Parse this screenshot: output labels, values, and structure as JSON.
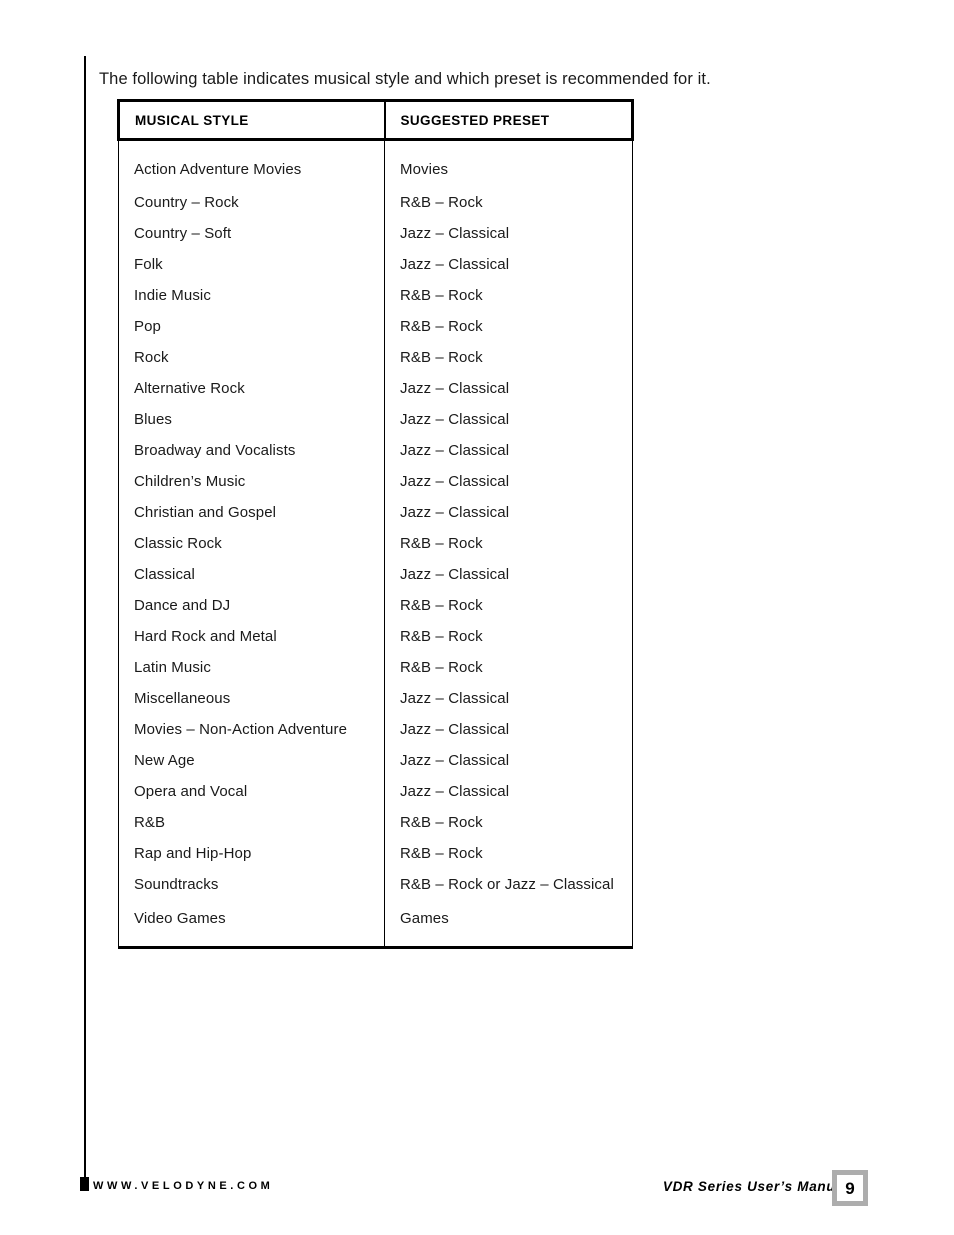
{
  "intro": {
    "text": "The following table indicates musical style and which preset is recommended for it."
  },
  "table": {
    "headers": {
      "style": "MUSICAL STYLE",
      "preset": "SUGGESTED PRESET"
    },
    "rows": [
      {
        "style": "Action Adventure Movies",
        "preset": "Movies"
      },
      {
        "style": "Country – Rock",
        "preset": "R&B – Rock"
      },
      {
        "style": "Country – Soft",
        "preset": "Jazz – Classical"
      },
      {
        "style": "Folk",
        "preset": "Jazz – Classical"
      },
      {
        "style": "Indie Music",
        "preset": "R&B – Rock"
      },
      {
        "style": "Pop",
        "preset": "R&B – Rock"
      },
      {
        "style": "Rock",
        "preset": "R&B – Rock"
      },
      {
        "style": "Alternative Rock",
        "preset": "Jazz – Classical"
      },
      {
        "style": "Blues",
        "preset": "Jazz – Classical"
      },
      {
        "style": "Broadway and Vocalists",
        "preset": "Jazz – Classical"
      },
      {
        "style": "Children’s Music",
        "preset": "Jazz – Classical"
      },
      {
        "style": "Christian and Gospel",
        "preset": "Jazz – Classical"
      },
      {
        "style": "Classic Rock",
        "preset": "R&B – Rock"
      },
      {
        "style": "Classical",
        "preset": "Jazz – Classical"
      },
      {
        "style": "Dance and DJ",
        "preset": "R&B – Rock"
      },
      {
        "style": "Hard Rock and Metal",
        "preset": "R&B – Rock"
      },
      {
        "style": "Latin Music",
        "preset": "R&B – Rock"
      },
      {
        "style": "Miscellaneous",
        "preset": "Jazz – Classical"
      },
      {
        "style": "Movies – Non-Action Adventure",
        "preset": "Jazz – Classical"
      },
      {
        "style": "New Age",
        "preset": "Jazz – Classical"
      },
      {
        "style": "Opera and Vocal",
        "preset": "Jazz – Classical"
      },
      {
        "style": "R&B",
        "preset": "R&B – Rock"
      },
      {
        "style": "Rap and Hip-Hop",
        "preset": "R&B – Rock"
      },
      {
        "style": "Soundtracks",
        "preset": "R&B – Rock or Jazz – Classical"
      },
      {
        "style": "Video Games",
        "preset": "Games"
      }
    ]
  },
  "footer": {
    "website": "WWW.VELODYNE.COM",
    "manual_title": "VDR Series User’s Manual",
    "page_number": "9",
    "page_box_border_color": "#adadad"
  }
}
